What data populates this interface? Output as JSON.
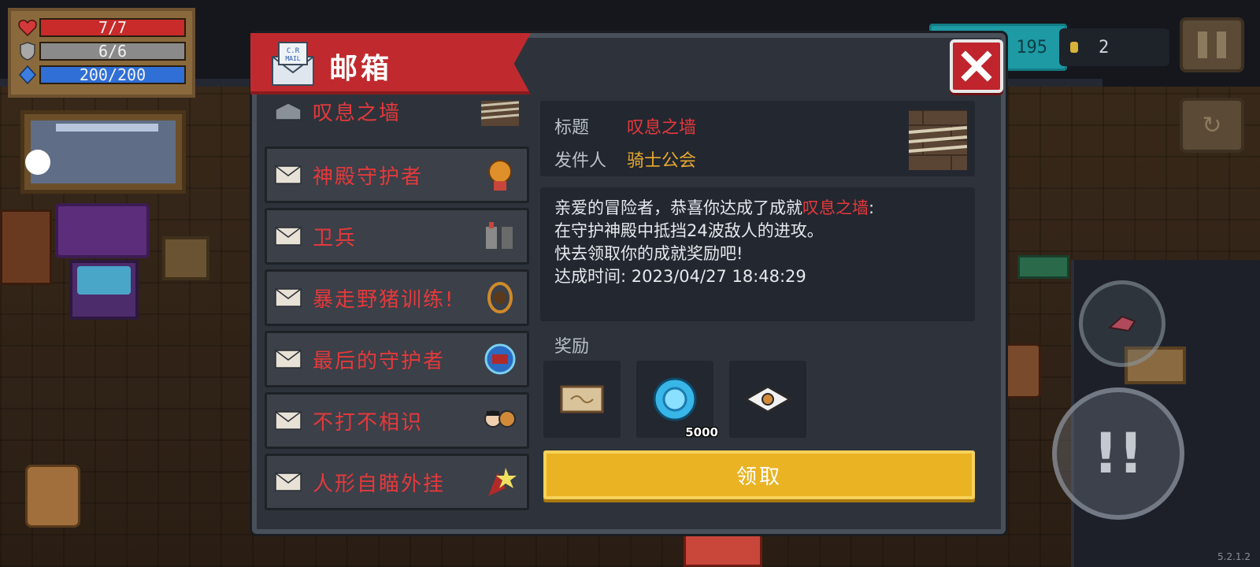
{
  "hud": {
    "hp": "7/7",
    "hp_fraction": 1.0,
    "armor": "6/6",
    "armor_fraction": 1.0,
    "energy": "200/200",
    "energy_fraction": 1.0,
    "gems": "195",
    "coins": "2",
    "version": "5.2.1.2"
  },
  "mailbox": {
    "title": "邮箱",
    "header_icon_text": "C.R MAIL",
    "items": [
      {
        "label": "叹息之墙",
        "icon": "wall-rope-icon",
        "opened": true
      },
      {
        "label": "神殿守护者",
        "icon": "temple-guardian-icon",
        "opened": false
      },
      {
        "label": "卫兵",
        "icon": "guards-icon",
        "opened": false
      },
      {
        "label": "暴走野猪训练!",
        "icon": "wild-boar-icon",
        "opened": false
      },
      {
        "label": "最后的守护者",
        "icon": "last-guardian-icon",
        "opened": false
      },
      {
        "label": "不打不相识",
        "icon": "fight-friends-icon",
        "opened": false
      },
      {
        "label": "人形自瞄外挂",
        "icon": "aimbot-icon",
        "opened": false
      }
    ],
    "detail": {
      "title_label": "标题",
      "title_value": "叹息之墙",
      "sender_label": "发件人",
      "sender_value": "骑士公会",
      "message_line1_prefix": "亲爱的冒险者，恭喜你达成了成就",
      "message_line1_highlight": "叹息之墙",
      "message_line1_suffix": ":",
      "message_line2": "在守护神殿中抵挡24波敌人的进攻。",
      "message_line3": "快去领取你的成就奖励吧!",
      "message_line4": "达成时间: 2023/04/27 18:48:29"
    },
    "rewards_label": "奖励",
    "rewards": [
      {
        "icon": "scroll-icon",
        "count": ""
      },
      {
        "icon": "blue-gem-icon",
        "count": "5000"
      },
      {
        "icon": "seed-card-icon",
        "count": ""
      }
    ],
    "claim_label": "领取"
  },
  "colors": {
    "header_red": "#c02a2e",
    "item_red": "#e5393b",
    "sender_gold": "#e7a92d",
    "claim_yellow": "#eab324",
    "panel_bg": "#2e333b"
  }
}
